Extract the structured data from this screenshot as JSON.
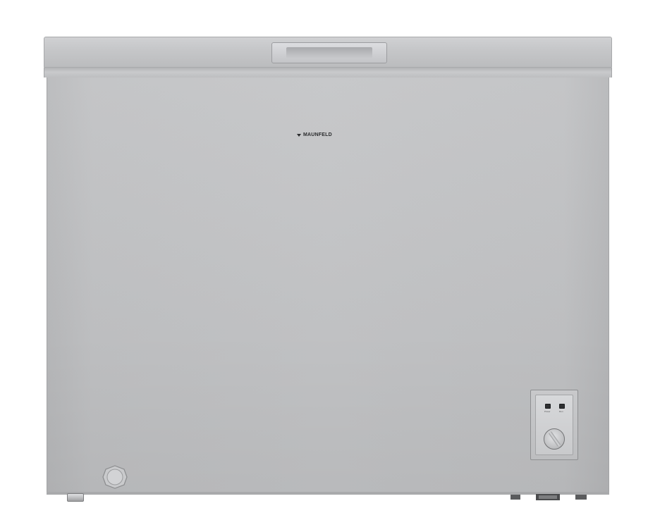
{
  "brand": {
    "logo_text": "MAUNFELD"
  },
  "control_panel": {
    "indicators": [
      "Power",
      "Run"
    ],
    "thermostat_knob": "thermostat-knob"
  },
  "colors": {
    "body": "#c4c5c7",
    "lid": "#c6c7c9",
    "background": "#ffffff"
  },
  "icons": {
    "logo": "maunfeld-logo-icon",
    "drain": "drain-plug-icon"
  }
}
